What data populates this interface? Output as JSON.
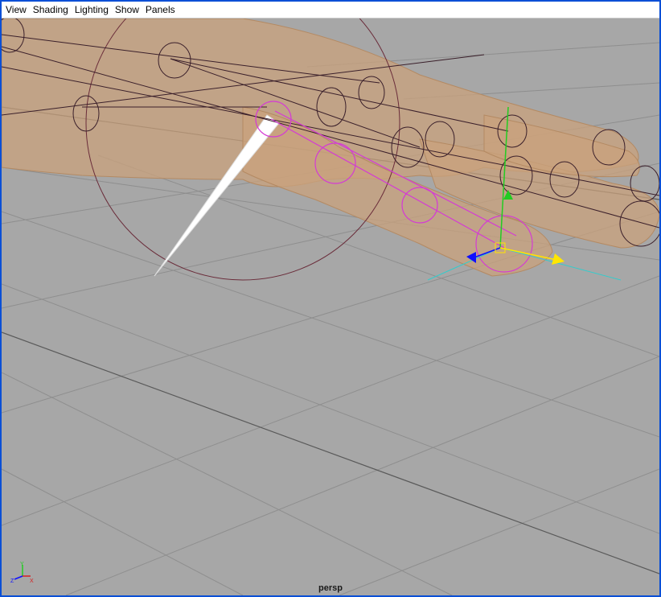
{
  "menubar": {
    "items": [
      {
        "label": "View"
      },
      {
        "label": "Shading"
      },
      {
        "label": "Lighting"
      },
      {
        "label": "Show"
      },
      {
        "label": "Panels"
      }
    ]
  },
  "viewport": {
    "camera_name": "persp",
    "background_color": "#a7a7a7",
    "grid_color": "#8c8c8c",
    "mesh_color": "#c9a27c",
    "selected_joint_color": "#d43bd4",
    "joint_color": "#3a1f2a",
    "manipulator_colors": {
      "x": "#ffe600",
      "y": "#22cc22",
      "z": "#1010ff"
    }
  },
  "axis_indicator": {
    "y_label": "Y",
    "z_label": "Z",
    "x_label": "X"
  }
}
